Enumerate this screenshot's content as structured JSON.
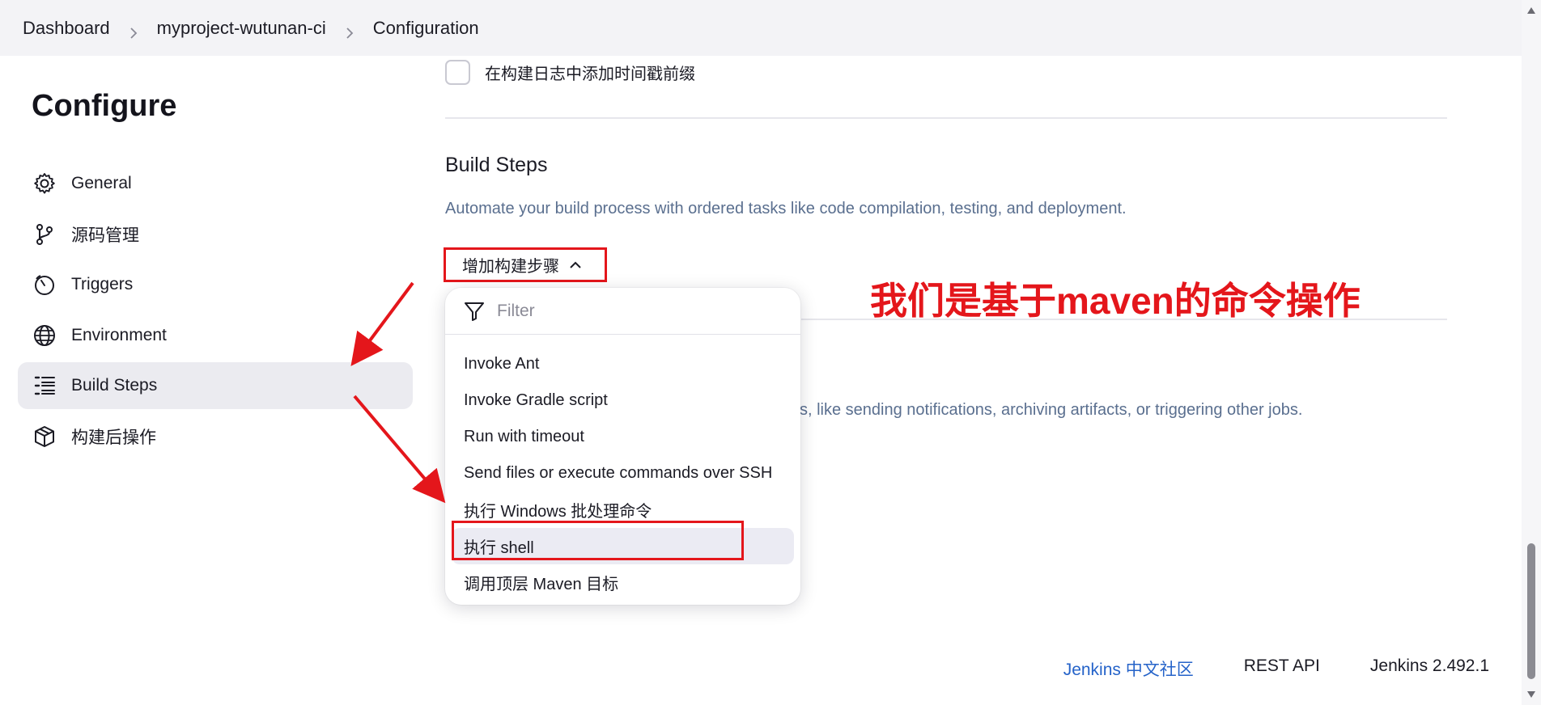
{
  "breadcrumb": {
    "items": [
      "Dashboard",
      "myproject-wutunan-ci",
      "Configuration"
    ]
  },
  "sidebar": {
    "title": "Configure",
    "items": [
      {
        "label": "General",
        "icon": "gear-icon"
      },
      {
        "label": "源码管理",
        "icon": "git-branch-icon"
      },
      {
        "label": "Triggers",
        "icon": "timer-icon"
      },
      {
        "label": "Environment",
        "icon": "globe-icon"
      },
      {
        "label": "Build Steps",
        "icon": "list-icon",
        "active": true
      },
      {
        "label": "构建后操作",
        "icon": "package-icon"
      }
    ]
  },
  "main": {
    "timestamp_checkbox_label": "在构建日志中添加时间戳前缀",
    "build_steps_title": "Build Steps",
    "build_steps_desc": "Automate your build process with ordered tasks like code compilation, testing, and deployment.",
    "add_step_label": "增加构建步骤",
    "post_build_desc_visible": "s, like sending notifications, archiving artifacts, or triggering other jobs."
  },
  "dropdown": {
    "filter_placeholder": "Filter",
    "items": [
      "Invoke Ant",
      "Invoke Gradle script",
      "Run with timeout",
      "Send files or execute commands over SSH",
      "执行 Windows 批处理命令",
      "执行 shell",
      "调用顶层 Maven 目标"
    ]
  },
  "annotation": {
    "text": "我们是基于maven的命令操作",
    "color": "#e4161b"
  },
  "footer": {
    "community_link": "Jenkins 中文社区",
    "rest_api": "REST API",
    "version": "Jenkins 2.492.1"
  },
  "colors": {
    "accent_red": "#e4161b",
    "link_blue": "#2563c9",
    "desc_gray_blue": "#5a6f8f"
  }
}
